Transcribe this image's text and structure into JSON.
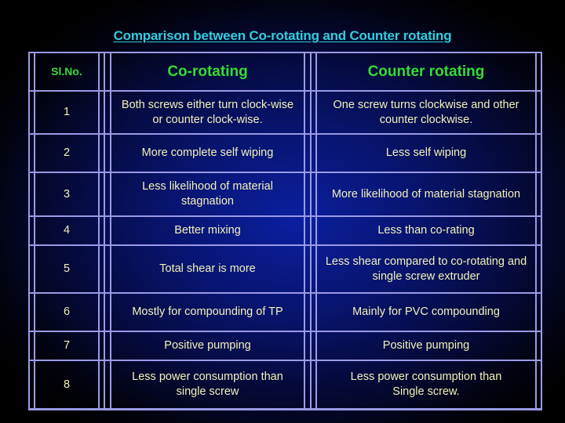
{
  "title": "Comparison between Co-rotating and Counter rotating",
  "colors": {
    "title": "#33ccdd",
    "header_text": "#33dd33",
    "body_text": "#f2f2b8",
    "grid_lines": "#9a9ae6"
  },
  "table": {
    "headers": [
      "Sl.No.",
      "Co-rotating",
      "Counter rotating"
    ],
    "rows": [
      {
        "sl": "1",
        "co": "Both screws either turn clock-wise or counter clock-wise.",
        "counter": "One screw turns clockwise and other counter clockwise."
      },
      {
        "sl": "2",
        "co": "More complete self wiping",
        "counter": "Less self wiping"
      },
      {
        "sl": "3",
        "co": "Less likelihood of material stagnation",
        "counter": "More likelihood of material stagnation"
      },
      {
        "sl": "4",
        "co": "Better mixing",
        "counter": "Less than co-rating"
      },
      {
        "sl": "5",
        "co": "Total shear is more",
        "counter": "Less shear compared to co-rotating and single screw extruder"
      },
      {
        "sl": "6",
        "co": "Mostly for compounding of TP",
        "counter": "Mainly for PVC compounding"
      },
      {
        "sl": "7",
        "co": "Positive pumping",
        "counter": "Positive pumping"
      },
      {
        "sl": "8",
        "co": "Less power consumption than single screw",
        "counter": "Less power consumption than Single screw."
      }
    ]
  }
}
